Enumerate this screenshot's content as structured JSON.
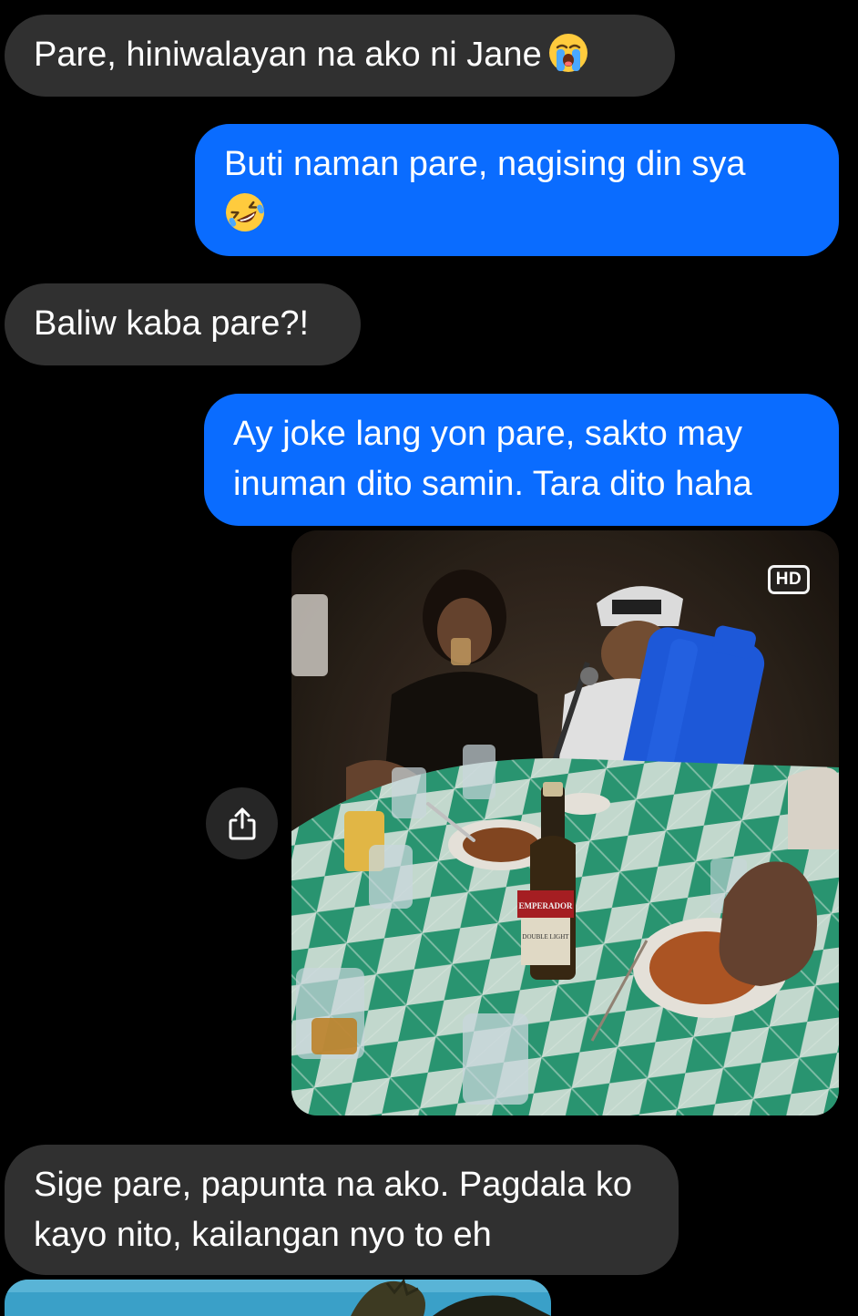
{
  "messages": [
    {
      "id": "m1",
      "direction": "incoming",
      "text": "Pare, hiniwalayan na ako ni Jane",
      "emoji": "loudly-crying-face-icon"
    },
    {
      "id": "m2",
      "direction": "outgoing",
      "text": "Buti naman pare, nagising din sya",
      "emoji": "rolling-on-floor-laughing-icon"
    },
    {
      "id": "m3",
      "direction": "incoming",
      "text": "Baliw kaba pare?!"
    },
    {
      "id": "m4",
      "direction": "outgoing",
      "text": "Ay joke lang yon pare, sakto may inuman dito samin. Tara dito haha"
    },
    {
      "id": "m5",
      "direction": "incoming",
      "text": "Sige pare, papunta na ako. Pagdala ko kayo nito, kailangan nyo to eh"
    }
  ],
  "photo": {
    "badge": "HD",
    "bottle_label_top": "EMPERADOR",
    "bottle_label_bottom": "DOUBLE LIGHT"
  },
  "share_button": {
    "icon": "share-icon"
  },
  "colors": {
    "background": "#000000",
    "incoming_bubble": "#303030",
    "outgoing_bubble": "#0a6cff",
    "text": "#ffffff",
    "table_green": "#2fa37a"
  }
}
